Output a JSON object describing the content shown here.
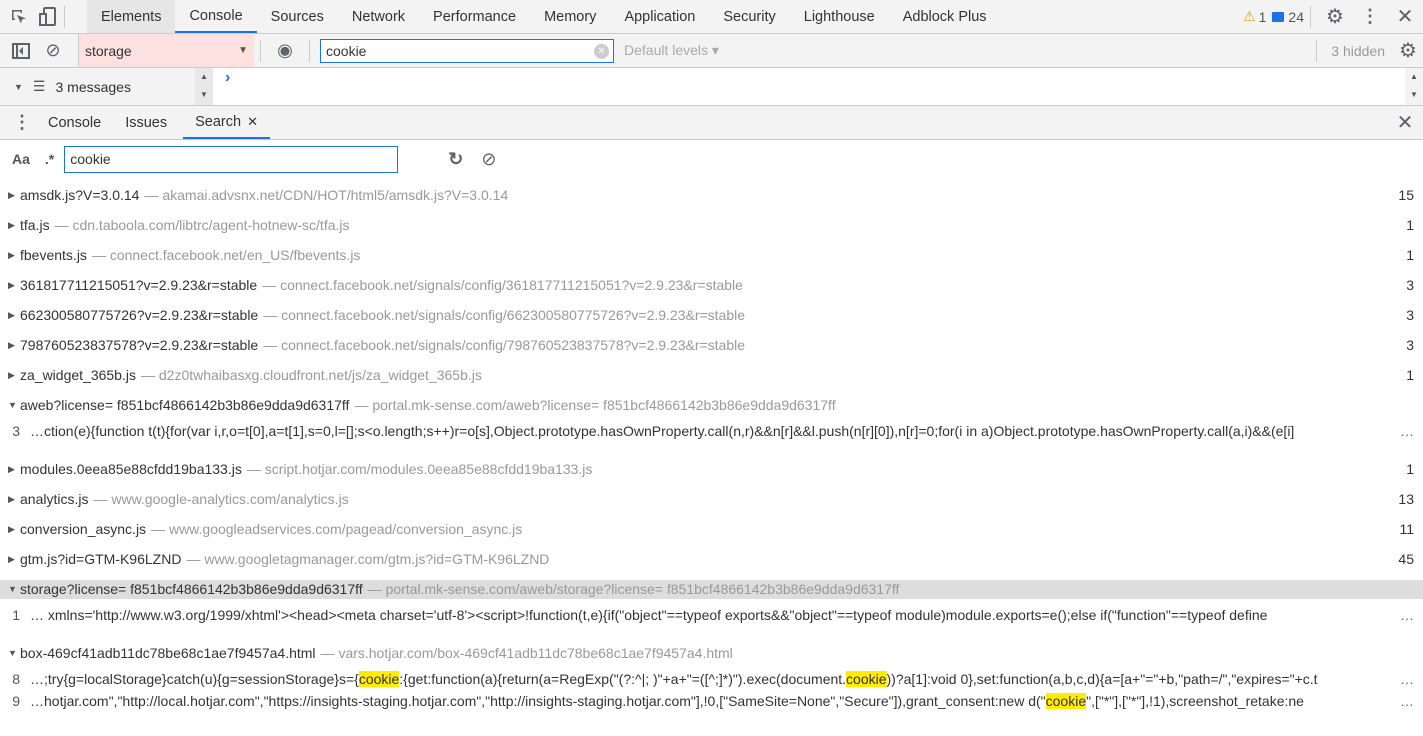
{
  "toolbar": {
    "tabs": [
      "Elements",
      "Console",
      "Sources",
      "Network",
      "Performance",
      "Memory",
      "Application",
      "Security",
      "Lighthouse",
      "Adblock Plus"
    ],
    "warnings": "1",
    "messages": "24"
  },
  "console": {
    "context": "storage",
    "filter": "cookie",
    "levels": "Default levels",
    "hidden": "3 hidden",
    "message_count": "3 messages",
    "prompt": "›"
  },
  "drawer": {
    "tabs": [
      "Console",
      "Issues",
      "Search"
    ],
    "case_label": "Aa",
    "regex_label": ".*",
    "query": "cookie"
  },
  "results": [
    {
      "file": "amsdk.js?V=3.0.14",
      "url": "akamai.advsnx.net/CDN/HOT/html5/amsdk.js?V=3.0.14",
      "count": "15"
    },
    {
      "file": "tfa.js",
      "url": "cdn.taboola.com/libtrc/agent-hotnew-sc/tfa.js",
      "count": "1"
    },
    {
      "file": "fbevents.js",
      "url": "connect.facebook.net/en_US/fbevents.js",
      "count": "1"
    },
    {
      "file": "361817711215051?v=2.9.23&r=stable",
      "url": "connect.facebook.net/signals/config/361817711215051?v=2.9.23&r=stable",
      "count": "3"
    },
    {
      "file": "662300580775726?v=2.9.23&r=stable",
      "url": "connect.facebook.net/signals/config/662300580775726?v=2.9.23&r=stable",
      "count": "3"
    },
    {
      "file": "798760523837578?v=2.9.23&r=stable",
      "url": "connect.facebook.net/signals/config/798760523837578?v=2.9.23&r=stable",
      "count": "3"
    },
    {
      "file": "za_widget_365b.js",
      "url": "d2z0twhaibasxg.cloudfront.net/js/za_widget_365b.js",
      "count": "1"
    },
    {
      "file": "aweb?license= f851bcf4866142b3b86e9dda9d6317ff",
      "url": "portal.mk-sense.com/aweb?license= f851bcf4866142b3b86e9dda9d6317ff",
      "count": "",
      "matches": [
        {
          "line": "3",
          "parts": [
            "…ction(e){function t(t){for(var i,r,o=t[0],a=t[1],s=0,l=[];s<o.length;s++)r=o[s],Object.prototype.hasOwnProperty.call(n,r)&&n[r]&&l.push(n[r][0]),n[r]=0;for(i in a)Object.prototype.hasOwnProperty.call(a,i)&&(e[i]"
          ]
        }
      ]
    },
    {
      "file": "modules.0eea85e88cfdd19ba133.js",
      "url": "script.hotjar.com/modules.0eea85e88cfdd19ba133.js",
      "count": "1"
    },
    {
      "file": "analytics.js",
      "url": "www.google-analytics.com/analytics.js",
      "count": "13"
    },
    {
      "file": "conversion_async.js",
      "url": "www.googleadservices.com/pagead/conversion_async.js",
      "count": "11"
    },
    {
      "file": "gtm.js?id=GTM-K96LZND",
      "url": "www.googletagmanager.com/gtm.js?id=GTM-K96LZND",
      "count": "45"
    },
    {
      "file": "storage?license= f851bcf4866142b3b86e9dda9d6317ff",
      "url": "portal.mk-sense.com/aweb/storage?license= f851bcf4866142b3b86e9dda9d6317ff",
      "count": "",
      "selected": true,
      "matches": [
        {
          "line": "1",
          "parts": [
            "… xmlns='http://www.w3.org/1999/xhtml'><head><meta charset='utf-8'><script>!function(t,e){if(\"object\"==typeof exports&&\"object\"==typeof module)module.exports=e();else if(\"function\"==typeof define"
          ]
        }
      ]
    },
    {
      "file": "box-469cf41adb11dc78be68c1ae7f9457a4.html",
      "url": "vars.hotjar.com/box-469cf41adb11dc78be68c1ae7f9457a4.html",
      "count": "",
      "matches": [
        {
          "line": "8",
          "parts": [
            "…;try{g=localStorage}catch(u){g=sessionStorage}s={",
            "cookie",
            ":{get:function(a){return(a=RegExp(\"(?:^|; )\"+a+\"=([^;]*)\").exec(document.",
            "cookie",
            "))?a[1]:void 0},set:function(a,b,c,d){a=[a+\"=\"+b,\"path=/\",\"expires=\"+c.t"
          ]
        },
        {
          "line": "9",
          "parts": [
            "…hotjar.com\",\"http://local.hotjar.com\",\"https://insights-staging.hotjar.com\",\"http://insights-staging.hotjar.com\"],!0,[\"SameSite=None\",\"Secure\"]),grant_consent:new d(\"",
            "cookie",
            "\",[\"*\"],[\"*\"],!1),screenshot_retake:ne"
          ]
        }
      ]
    }
  ],
  "ellipsis": "…"
}
